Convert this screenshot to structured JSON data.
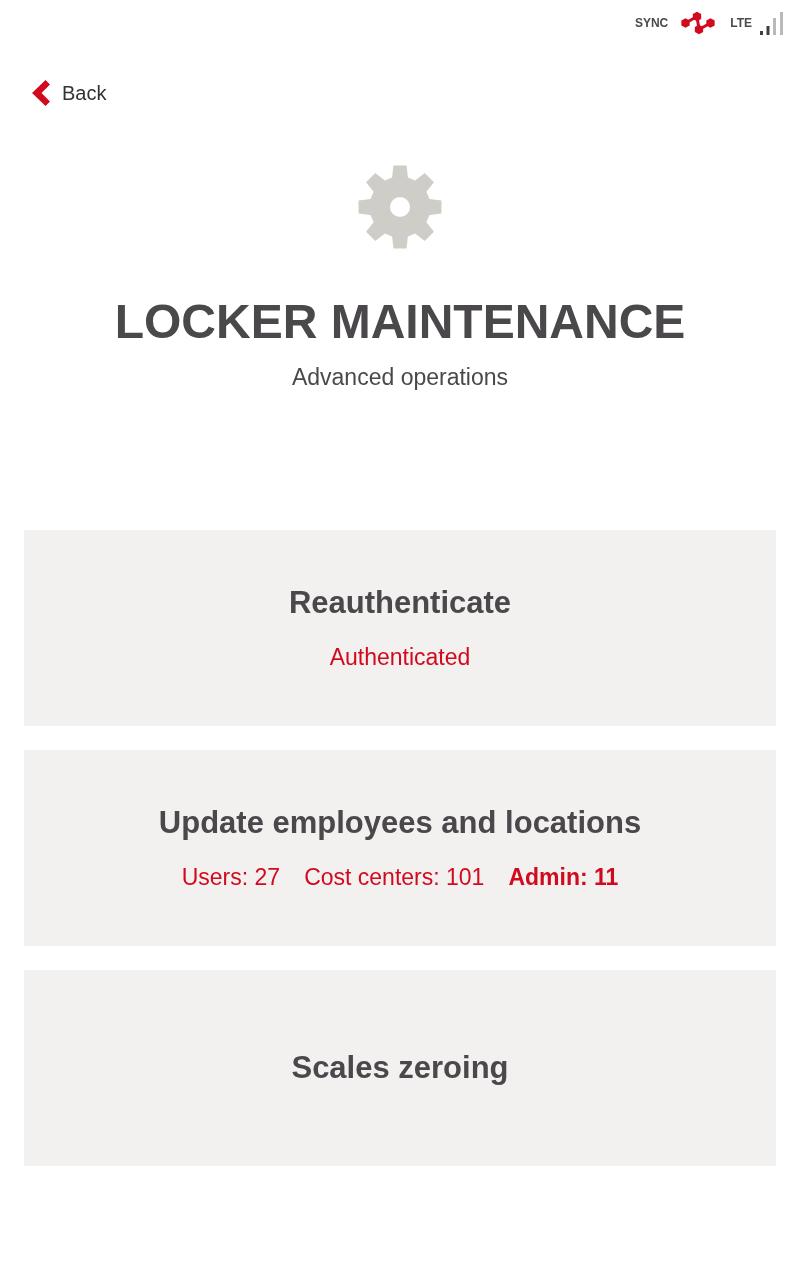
{
  "status_bar": {
    "sync_label": "SYNC",
    "network_label": "LTE"
  },
  "back": {
    "label": "Back"
  },
  "header": {
    "title": "LOCKER MAINTENANCE",
    "subtitle": "Advanced operations"
  },
  "cards": [
    {
      "title": "Reauthenticate",
      "details": [
        {
          "text": "Authenticated",
          "emphasized": false
        }
      ]
    },
    {
      "title": "Update employees and locations",
      "details": [
        {
          "text": "Users: 27",
          "emphasized": false
        },
        {
          "text": "Cost centers: 101",
          "emphasized": false
        },
        {
          "text": "Admin: 11",
          "emphasized": true
        }
      ]
    },
    {
      "title": "Scales zeroing"
    }
  ]
}
